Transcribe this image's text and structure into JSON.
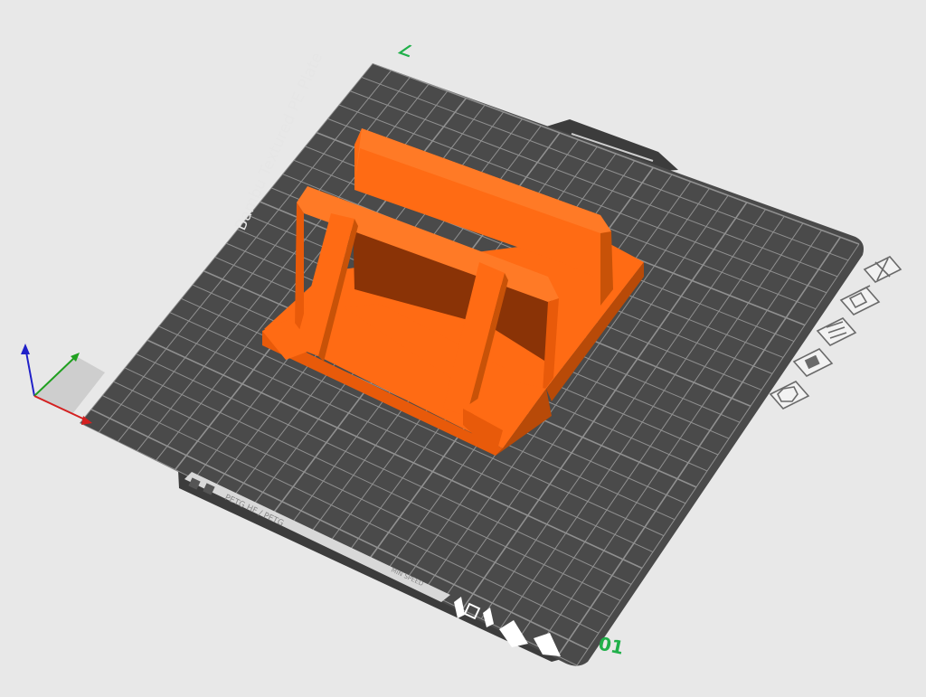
{
  "plate": {
    "name": "Bambu Textured PE Plate",
    "label_text": "PETG HF / PETG",
    "secondary_text": "MIN SPEED",
    "plate_number": "01",
    "corner_mark": "∠"
  },
  "model": {
    "color": "#ff6b14",
    "name": "stand"
  },
  "colors": {
    "background": "#e8e8e8",
    "bed": "#4a4a4a",
    "grid": "#a8a8a8",
    "accent_green": "#20b04a",
    "axis_x": "#d42020",
    "axis_y": "#20a020",
    "axis_z": "#2020c8"
  },
  "plate_tools": [
    {
      "id": "close",
      "icon": "close-icon"
    },
    {
      "id": "arrange",
      "icon": "arrange-icon"
    },
    {
      "id": "orient",
      "icon": "orient-icon"
    },
    {
      "id": "lock",
      "icon": "lock-icon"
    },
    {
      "id": "settings",
      "icon": "gear-icon"
    }
  ]
}
